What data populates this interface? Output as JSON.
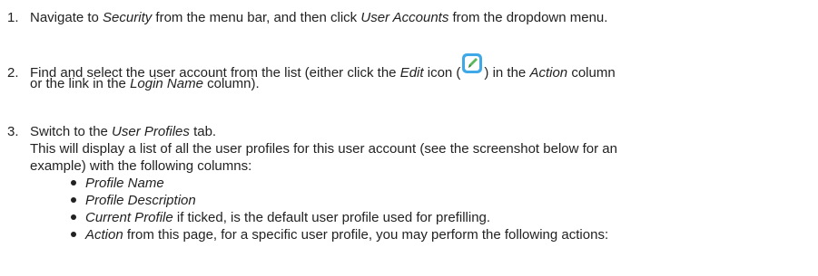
{
  "steps": [
    {
      "number": "1.",
      "text_a": "Navigate to ",
      "em_a": "Security",
      "text_b": " from the menu bar, and then click ",
      "em_b": "User Accounts",
      "text_c": " from the dropdown menu."
    },
    {
      "number": "2.",
      "text_a": "Find and select the user account from the list (either click the ",
      "em_a": "Edit",
      "text_b": " icon (",
      "icon": "edit-icon",
      "text_c": ") in the ",
      "em_b": "Action",
      "text_d": " column",
      "line2_a": "or the link in the ",
      "line2_em": "Login Name",
      "line2_b": " column)."
    },
    {
      "number": "3.",
      "text_a": "Switch to the ",
      "em_a": "User Profiles",
      "text_b": " tab.",
      "line2": "This will display a list of all the user profiles for this user account (see the screenshot below for an",
      "line3": "example) with the following columns:",
      "bullets": [
        {
          "em": "Profile Name",
          "text": ""
        },
        {
          "em": "Profile Description",
          "text": ""
        },
        {
          "em": "Current Profile",
          "text": " if ticked, is the default user profile used for prefilling."
        },
        {
          "em": "Action",
          "text": " from this page, for a specific user profile, you may perform the following actions:"
        }
      ]
    }
  ],
  "colors": {
    "text": "#222222",
    "icon_bg": "#3fa9e8",
    "icon_pencil": "#5cb85c"
  }
}
